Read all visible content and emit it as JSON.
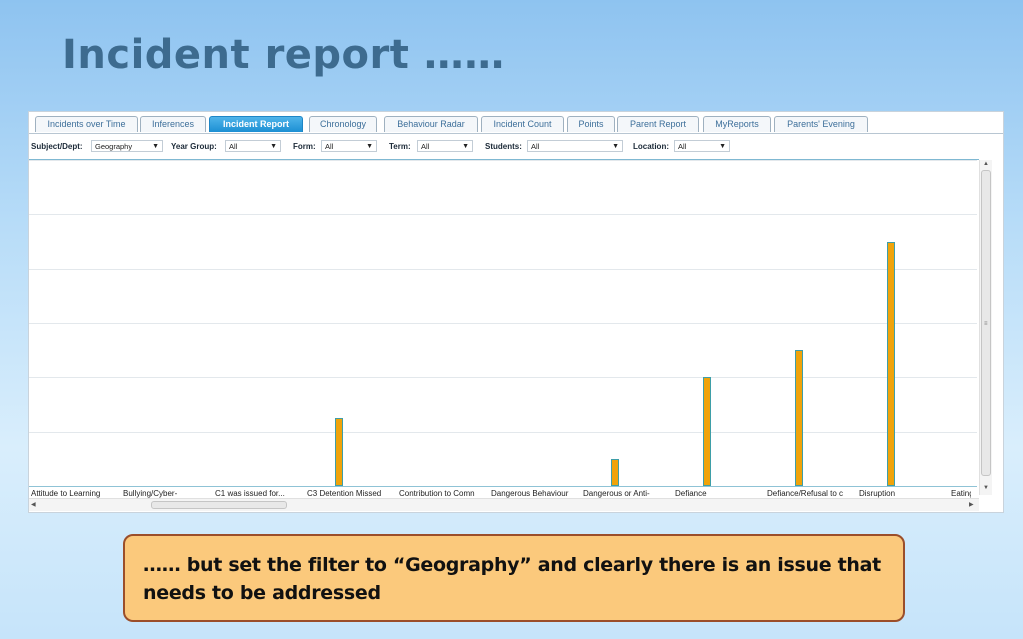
{
  "slide": {
    "title": "Incident report ……",
    "note": "…… but set the filter to “Geography” and clearly there is an issue that needs to be addressed"
  },
  "tabs": [
    {
      "label": "Incidents over Time",
      "active": false
    },
    {
      "label": "Inferences",
      "active": false
    },
    {
      "label": "Incident Report",
      "active": true
    },
    {
      "label": "Chronology",
      "active": false
    },
    {
      "label": "Behaviour Radar",
      "active": false
    },
    {
      "label": "Incident Count",
      "active": false
    },
    {
      "label": "Points",
      "active": false
    },
    {
      "label": "Parent Report",
      "active": false
    },
    {
      "label": "MyReports",
      "active": false
    },
    {
      "label": "Parents' Evening",
      "active": false
    }
  ],
  "filters": {
    "subject": {
      "label": "Subject/Dept:",
      "value": "Geography"
    },
    "year": {
      "label": "Year Group:",
      "value": "All"
    },
    "form": {
      "label": "Form:",
      "value": "All"
    },
    "term": {
      "label": "Term:",
      "value": "All"
    },
    "students": {
      "label": "Students:",
      "value": "All"
    },
    "location": {
      "label": "Location:",
      "value": "All"
    }
  },
  "icons": {
    "dropdown": "chevron-down-icon",
    "scroll_up": "arrow-up-icon",
    "scroll_down": "arrow-down-icon",
    "scroll_left": "arrow-left-icon",
    "scroll_right": "arrow-right-icon"
  },
  "colors": {
    "bar": "#f0a30a",
    "active_tab": "#1c8fd3",
    "title": "#3d6b8f",
    "note_bg": "#fbc97c"
  },
  "chart_data": {
    "type": "bar",
    "categories": [
      "Attitude to Learning",
      "Bullying/Cyber-",
      "C1 was issued for...",
      "C3 Detention Missed",
      "Contribution to Comn",
      "Dangerous Behaviour",
      "Dangerous or Anti-",
      "Defiance",
      "Defiance/Refusal to c",
      "Disruption",
      "Eating"
    ],
    "values": [
      0,
      0,
      0,
      5,
      0,
      0,
      2,
      8,
      10,
      18,
      1
    ],
    "ylim": [
      0,
      24
    ],
    "grid": true
  }
}
